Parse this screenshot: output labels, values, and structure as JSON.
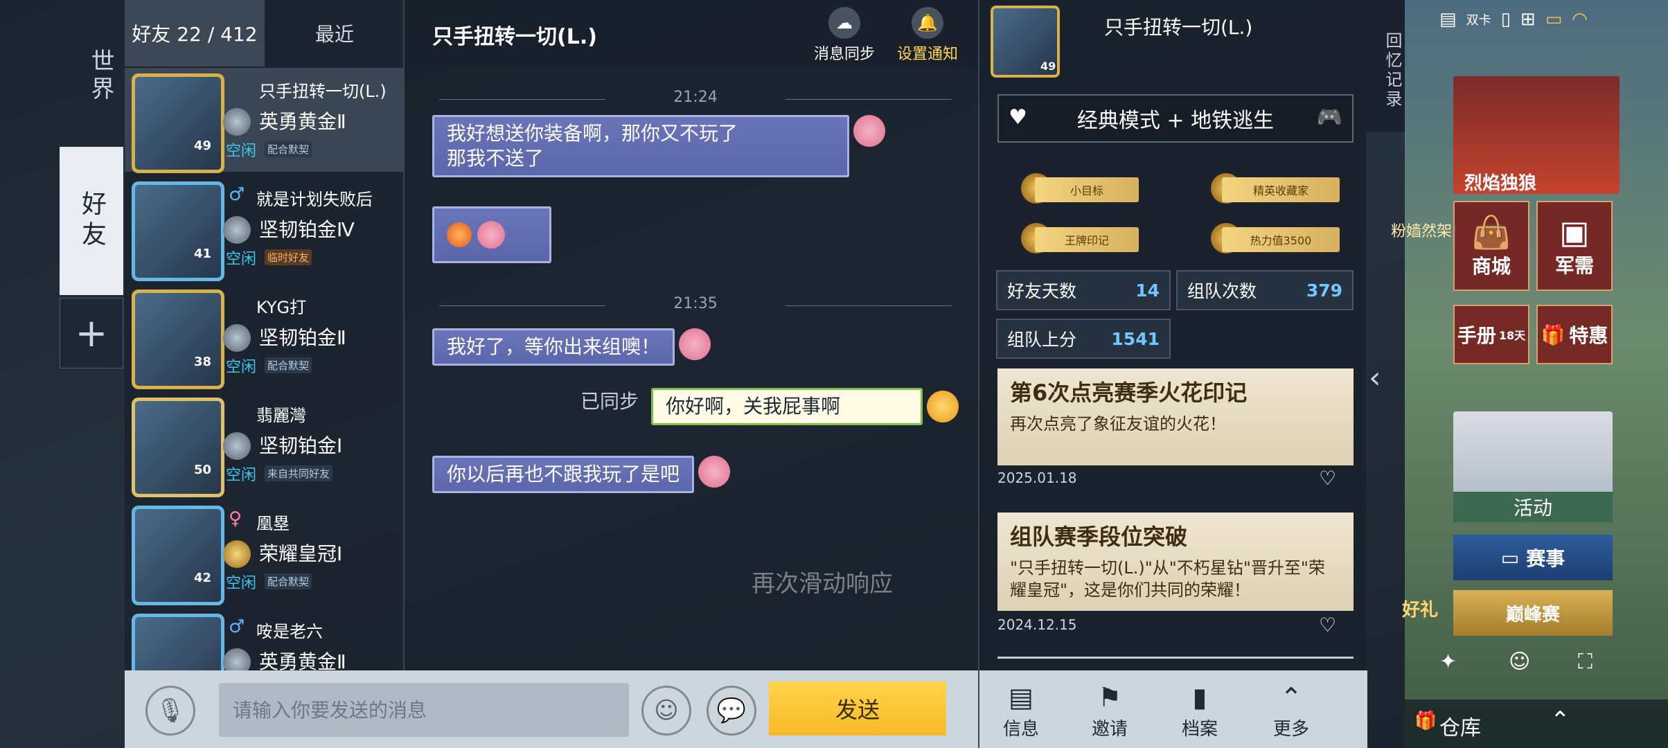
{
  "left_tabs": {
    "world": "世界",
    "friends": "好友",
    "add": "+"
  },
  "friend_tabs": {
    "friends": "好友 22 / 412",
    "recent": "最近"
  },
  "friends": [
    {
      "name": "只手扭转一切(L.)",
      "rank": "英勇黄金Ⅱ",
      "level": "49",
      "status": "空闲",
      "tag": "配合默契",
      "gender": ""
    },
    {
      "name": "就是计划失败后",
      "rank": "坚韧铂金Ⅳ",
      "level": "41",
      "status": "空闲",
      "tag": "临时好友",
      "gender": "♂"
    },
    {
      "name": "KYG打",
      "rank": "坚韧铂金Ⅱ",
      "level": "38",
      "status": "空闲",
      "tag": "配合默契",
      "gender": ""
    },
    {
      "name": "翡麗灣",
      "rank": "坚韧铂金Ⅰ",
      "level": "50",
      "status": "空闲",
      "tag": "来自共同好友",
      "gender": ""
    },
    {
      "name": "凰塁",
      "rank": "荣耀皇冠Ⅰ",
      "level": "42",
      "status": "空闲",
      "tag": "配合默契",
      "gender": "♀"
    },
    {
      "name": "咹是老六",
      "rank": "英勇黄金Ⅱ",
      "level": "",
      "status": "",
      "tag": "",
      "gender": "♂"
    }
  ],
  "chat": {
    "title": "只手扭转一切(L.)",
    "sync_label": "消息同步",
    "notify_label": "设置通知",
    "time1": "21:24",
    "msg1": "我好想送你装备啊，那你又不玩了\n那我不送了",
    "time2": "21:35",
    "msg2": "我好了，等你出来组噢！",
    "synced": "已同步",
    "my_msg": "你好啊，关我屁事啊",
    "msg3": "你以后再也不跟我玩了是吧",
    "hint": "再次滑动响应"
  },
  "input": {
    "placeholder": "请输入你要发送的消息",
    "send": "发送"
  },
  "profile": {
    "name": "只手扭转一切(L.)",
    "level": "49",
    "mode": "经典模式 + 地铁逃生",
    "badges": [
      "小目标",
      "精英收藏家",
      "王牌印记",
      "热力值3500"
    ],
    "stats": [
      {
        "label": "好友天数",
        "value": "14"
      },
      {
        "label": "组队次数",
        "value": "379"
      },
      {
        "label": "组队上分",
        "value": "1541"
      }
    ],
    "cards": [
      {
        "title": "第6次点亮赛季火花印记",
        "text": "再次点亮了象征友谊的火花！",
        "date": "2025.01.18"
      },
      {
        "title": "组队赛季段位突破",
        "text": "\"只手扭转一切(L.)\"从\"不朽星钻\"晋升至\"荣耀皇冠\"，这是你们共同的荣耀！",
        "date": "2024.12.15"
      }
    ],
    "tabs": [
      "信息",
      "邀请",
      "档案",
      "更多"
    ]
  },
  "side": {
    "history": "回忆记录",
    "sim": "双卡",
    "hero_text": "烈焰独狼",
    "promo_text": "粉嫱然架!",
    "shop": "商城",
    "supply": "军需",
    "handbook": "手册",
    "handbook_days": "18天",
    "sale": "特惠",
    "activity": "活动",
    "match": "赛事",
    "peak": "巅峰赛",
    "gift": "好礼",
    "warehouse": "仓库"
  }
}
